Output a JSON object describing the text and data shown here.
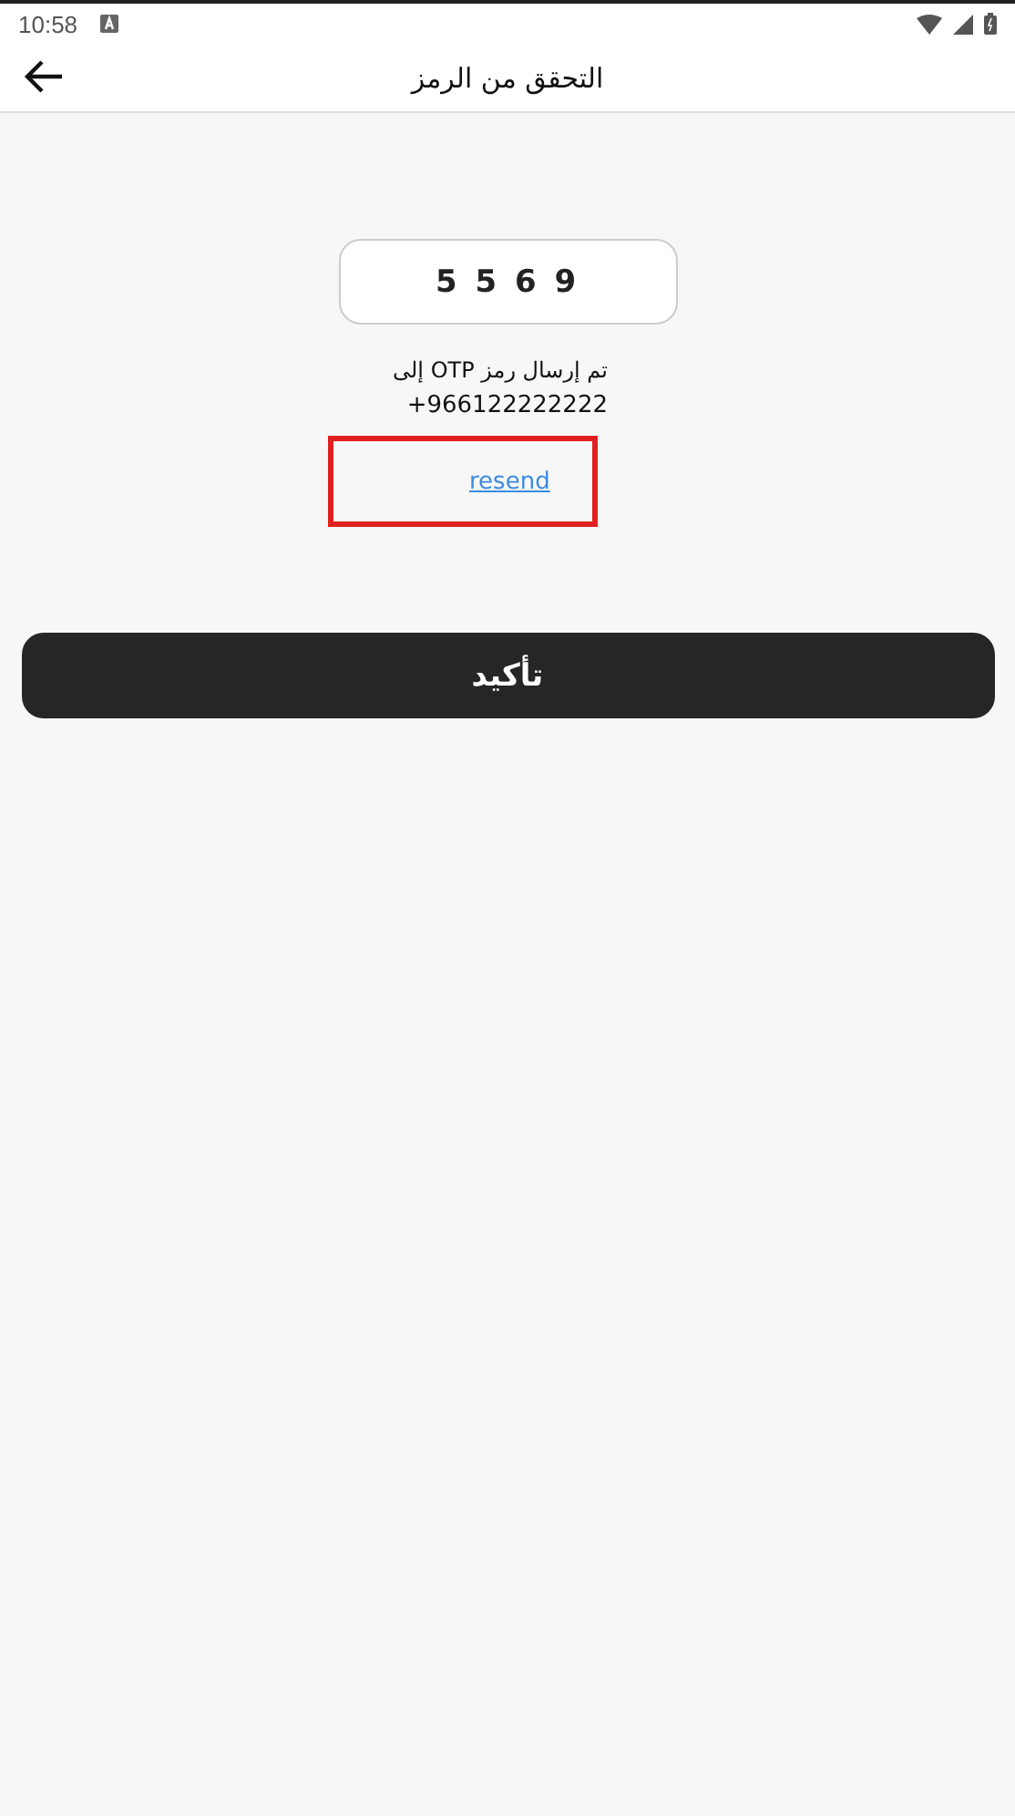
{
  "status_bar": {
    "time": "10:58"
  },
  "app_bar": {
    "title": "التحقق من الرمز"
  },
  "otp_field": {
    "value": "5 5 6 9"
  },
  "message": "تم إرسال رمز OTP إلى",
  "phone": "+966122222222",
  "resend_link": "resend",
  "confirm_button": "تأكيد"
}
